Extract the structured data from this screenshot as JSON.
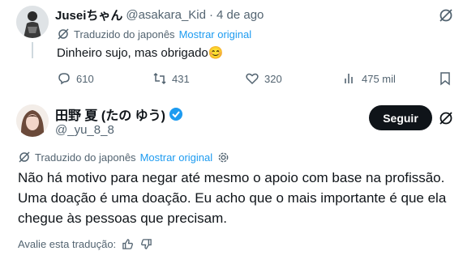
{
  "reply": {
    "author_name": "Juseiちゃん",
    "author_handle": "@asakara_Kid",
    "separator": "·",
    "timestamp": "4 de ago",
    "translated_label": "Traduzido do japonês",
    "show_original": "Mostrar original",
    "text": "Dinheiro sujo, mas obrigado",
    "emoji": "😊",
    "stats": {
      "replies": "610",
      "reposts": "431",
      "likes": "320",
      "views": "475 mil"
    }
  },
  "main_post": {
    "author_name": "田野 夏 (たの ゆう)",
    "author_handle": "@_yu_8_8",
    "follow_label": "Seguir",
    "translated_label": "Traduzido do japonês",
    "show_original": "Mostrar original",
    "text_line1": "Não há motivo para negar até mesmo o apoio com base na profissão.",
    "text_line2": "Uma doação é uma doação. Eu acho que o mais importante é que ela",
    "text_line3": "chegue às pessoas que precisam.",
    "rate_label": "Avalie esta tradução:"
  },
  "colors": {
    "accent": "#1d9bf0",
    "text": "#0f1419",
    "muted": "#536471",
    "follow_bg": "#0f1419"
  }
}
